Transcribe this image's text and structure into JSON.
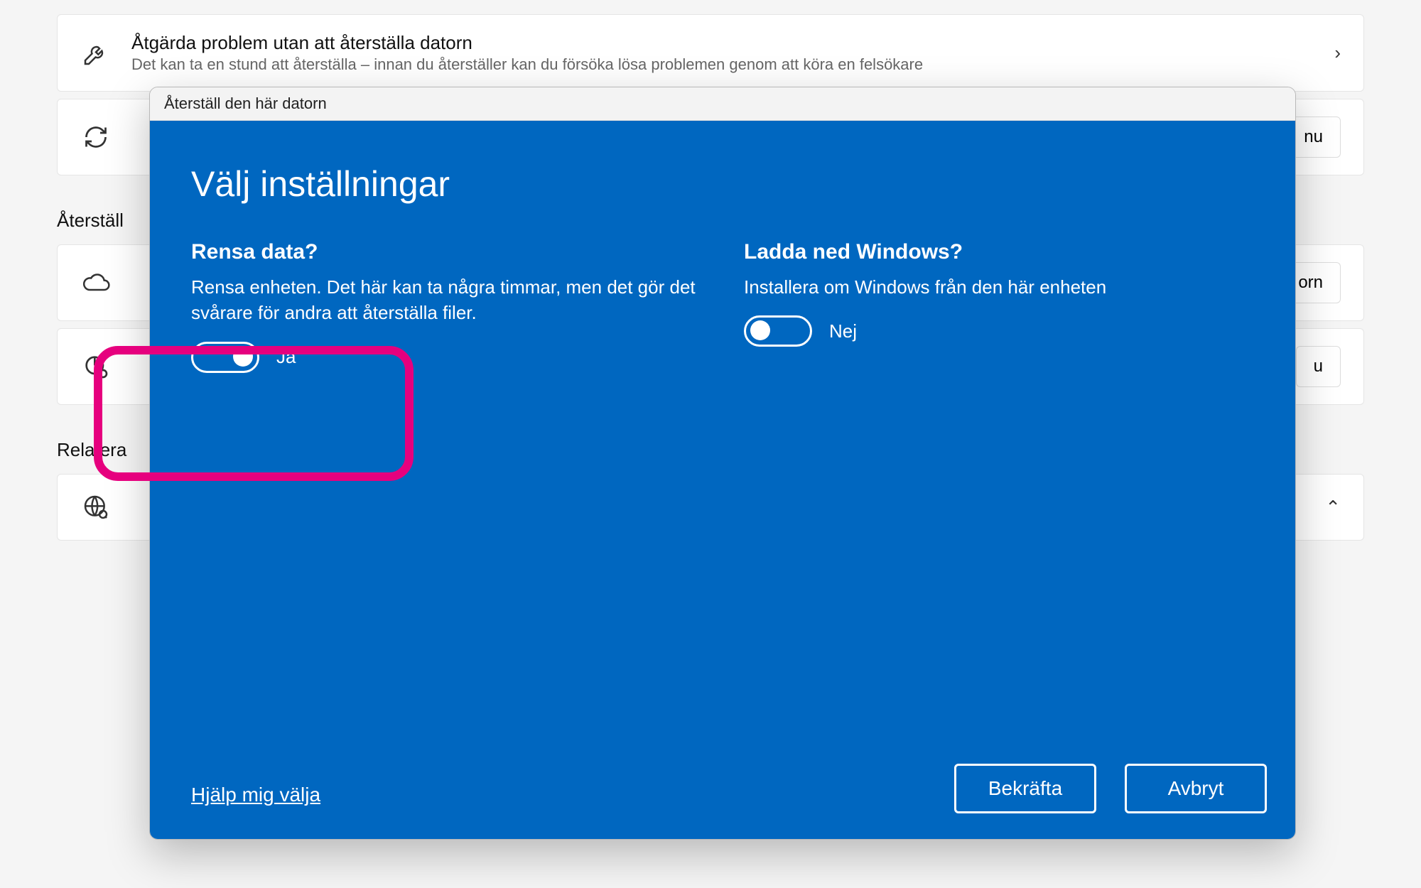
{
  "bg": {
    "card1_title": "Åtgärda problem utan att återställa datorn",
    "card1_sub": "Det kan ta en stund att återställa – innan du återställer kan du försöka lösa problemen genom att köra en felsökare",
    "card2_btn": "nu",
    "section1": "Återställ",
    "card3_btn": "orn",
    "card4_btn": "u",
    "section2": "Relatera"
  },
  "dialog": {
    "window_title": "Återställ den här datorn",
    "heading": "Välj inställningar",
    "clean": {
      "title": "Rensa data?",
      "desc": "Rensa enheten. Det här kan ta några timmar, men det gör det svårare för andra att återställa filer.",
      "value": "Ja"
    },
    "download": {
      "title": "Ladda ned Windows?",
      "desc": "Installera om Windows från den här enheten",
      "value": "Nej"
    },
    "help": "Hjälp mig välja",
    "confirm": "Bekräfta",
    "cancel": "Avbryt"
  }
}
